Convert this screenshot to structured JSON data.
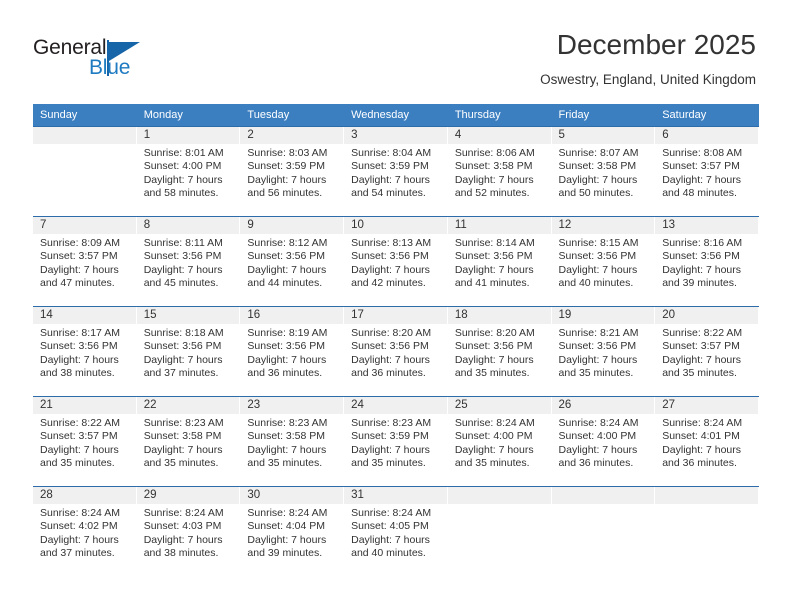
{
  "brand": {
    "name_part1": "General",
    "name_part2": "Blue",
    "logo_icon": "triangle-flag-icon",
    "color_primary": "#1565a8",
    "color_text": "#231f20"
  },
  "header": {
    "title": "December 2025",
    "subtitle": "Oswestry, England, United Kingdom"
  },
  "colors": {
    "header_row_bg": "#3c7fc1",
    "header_row_text": "#ffffff",
    "day_number_bg": "#f0f0f0",
    "row_divider": "#2d6ca8",
    "body_text": "#333333"
  },
  "calendar": {
    "weekday_headers": [
      "Sunday",
      "Monday",
      "Tuesday",
      "Wednesday",
      "Thursday",
      "Friday",
      "Saturday"
    ],
    "weeks": [
      [
        {
          "day": "",
          "sunrise": "",
          "sunset": "",
          "daylight_line1": "",
          "daylight_line2": "",
          "empty": true
        },
        {
          "day": "1",
          "sunrise": "Sunrise: 8:01 AM",
          "sunset": "Sunset: 4:00 PM",
          "daylight_line1": "Daylight: 7 hours",
          "daylight_line2": "and 58 minutes.",
          "empty": false
        },
        {
          "day": "2",
          "sunrise": "Sunrise: 8:03 AM",
          "sunset": "Sunset: 3:59 PM",
          "daylight_line1": "Daylight: 7 hours",
          "daylight_line2": "and 56 minutes.",
          "empty": false
        },
        {
          "day": "3",
          "sunrise": "Sunrise: 8:04 AM",
          "sunset": "Sunset: 3:59 PM",
          "daylight_line1": "Daylight: 7 hours",
          "daylight_line2": "and 54 minutes.",
          "empty": false
        },
        {
          "day": "4",
          "sunrise": "Sunrise: 8:06 AM",
          "sunset": "Sunset: 3:58 PM",
          "daylight_line1": "Daylight: 7 hours",
          "daylight_line2": "and 52 minutes.",
          "empty": false
        },
        {
          "day": "5",
          "sunrise": "Sunrise: 8:07 AM",
          "sunset": "Sunset: 3:58 PM",
          "daylight_line1": "Daylight: 7 hours",
          "daylight_line2": "and 50 minutes.",
          "empty": false
        },
        {
          "day": "6",
          "sunrise": "Sunrise: 8:08 AM",
          "sunset": "Sunset: 3:57 PM",
          "daylight_line1": "Daylight: 7 hours",
          "daylight_line2": "and 48 minutes.",
          "empty": false
        }
      ],
      [
        {
          "day": "7",
          "sunrise": "Sunrise: 8:09 AM",
          "sunset": "Sunset: 3:57 PM",
          "daylight_line1": "Daylight: 7 hours",
          "daylight_line2": "and 47 minutes.",
          "empty": false
        },
        {
          "day": "8",
          "sunrise": "Sunrise: 8:11 AM",
          "sunset": "Sunset: 3:56 PM",
          "daylight_line1": "Daylight: 7 hours",
          "daylight_line2": "and 45 minutes.",
          "empty": false
        },
        {
          "day": "9",
          "sunrise": "Sunrise: 8:12 AM",
          "sunset": "Sunset: 3:56 PM",
          "daylight_line1": "Daylight: 7 hours",
          "daylight_line2": "and 44 minutes.",
          "empty": false
        },
        {
          "day": "10",
          "sunrise": "Sunrise: 8:13 AM",
          "sunset": "Sunset: 3:56 PM",
          "daylight_line1": "Daylight: 7 hours",
          "daylight_line2": "and 42 minutes.",
          "empty": false
        },
        {
          "day": "11",
          "sunrise": "Sunrise: 8:14 AM",
          "sunset": "Sunset: 3:56 PM",
          "daylight_line1": "Daylight: 7 hours",
          "daylight_line2": "and 41 minutes.",
          "empty": false
        },
        {
          "day": "12",
          "sunrise": "Sunrise: 8:15 AM",
          "sunset": "Sunset: 3:56 PM",
          "daylight_line1": "Daylight: 7 hours",
          "daylight_line2": "and 40 minutes.",
          "empty": false
        },
        {
          "day": "13",
          "sunrise": "Sunrise: 8:16 AM",
          "sunset": "Sunset: 3:56 PM",
          "daylight_line1": "Daylight: 7 hours",
          "daylight_line2": "and 39 minutes.",
          "empty": false
        }
      ],
      [
        {
          "day": "14",
          "sunrise": "Sunrise: 8:17 AM",
          "sunset": "Sunset: 3:56 PM",
          "daylight_line1": "Daylight: 7 hours",
          "daylight_line2": "and 38 minutes.",
          "empty": false
        },
        {
          "day": "15",
          "sunrise": "Sunrise: 8:18 AM",
          "sunset": "Sunset: 3:56 PM",
          "daylight_line1": "Daylight: 7 hours",
          "daylight_line2": "and 37 minutes.",
          "empty": false
        },
        {
          "day": "16",
          "sunrise": "Sunrise: 8:19 AM",
          "sunset": "Sunset: 3:56 PM",
          "daylight_line1": "Daylight: 7 hours",
          "daylight_line2": "and 36 minutes.",
          "empty": false
        },
        {
          "day": "17",
          "sunrise": "Sunrise: 8:20 AM",
          "sunset": "Sunset: 3:56 PM",
          "daylight_line1": "Daylight: 7 hours",
          "daylight_line2": "and 36 minutes.",
          "empty": false
        },
        {
          "day": "18",
          "sunrise": "Sunrise: 8:20 AM",
          "sunset": "Sunset: 3:56 PM",
          "daylight_line1": "Daylight: 7 hours",
          "daylight_line2": "and 35 minutes.",
          "empty": false
        },
        {
          "day": "19",
          "sunrise": "Sunrise: 8:21 AM",
          "sunset": "Sunset: 3:56 PM",
          "daylight_line1": "Daylight: 7 hours",
          "daylight_line2": "and 35 minutes.",
          "empty": false
        },
        {
          "day": "20",
          "sunrise": "Sunrise: 8:22 AM",
          "sunset": "Sunset: 3:57 PM",
          "daylight_line1": "Daylight: 7 hours",
          "daylight_line2": "and 35 minutes.",
          "empty": false
        }
      ],
      [
        {
          "day": "21",
          "sunrise": "Sunrise: 8:22 AM",
          "sunset": "Sunset: 3:57 PM",
          "daylight_line1": "Daylight: 7 hours",
          "daylight_line2": "and 35 minutes.",
          "empty": false
        },
        {
          "day": "22",
          "sunrise": "Sunrise: 8:23 AM",
          "sunset": "Sunset: 3:58 PM",
          "daylight_line1": "Daylight: 7 hours",
          "daylight_line2": "and 35 minutes.",
          "empty": false
        },
        {
          "day": "23",
          "sunrise": "Sunrise: 8:23 AM",
          "sunset": "Sunset: 3:58 PM",
          "daylight_line1": "Daylight: 7 hours",
          "daylight_line2": "and 35 minutes.",
          "empty": false
        },
        {
          "day": "24",
          "sunrise": "Sunrise: 8:23 AM",
          "sunset": "Sunset: 3:59 PM",
          "daylight_line1": "Daylight: 7 hours",
          "daylight_line2": "and 35 minutes.",
          "empty": false
        },
        {
          "day": "25",
          "sunrise": "Sunrise: 8:24 AM",
          "sunset": "Sunset: 4:00 PM",
          "daylight_line1": "Daylight: 7 hours",
          "daylight_line2": "and 35 minutes.",
          "empty": false
        },
        {
          "day": "26",
          "sunrise": "Sunrise: 8:24 AM",
          "sunset": "Sunset: 4:00 PM",
          "daylight_line1": "Daylight: 7 hours",
          "daylight_line2": "and 36 minutes.",
          "empty": false
        },
        {
          "day": "27",
          "sunrise": "Sunrise: 8:24 AM",
          "sunset": "Sunset: 4:01 PM",
          "daylight_line1": "Daylight: 7 hours",
          "daylight_line2": "and 36 minutes.",
          "empty": false
        }
      ],
      [
        {
          "day": "28",
          "sunrise": "Sunrise: 8:24 AM",
          "sunset": "Sunset: 4:02 PM",
          "daylight_line1": "Daylight: 7 hours",
          "daylight_line2": "and 37 minutes.",
          "empty": false
        },
        {
          "day": "29",
          "sunrise": "Sunrise: 8:24 AM",
          "sunset": "Sunset: 4:03 PM",
          "daylight_line1": "Daylight: 7 hours",
          "daylight_line2": "and 38 minutes.",
          "empty": false
        },
        {
          "day": "30",
          "sunrise": "Sunrise: 8:24 AM",
          "sunset": "Sunset: 4:04 PM",
          "daylight_line1": "Daylight: 7 hours",
          "daylight_line2": "and 39 minutes.",
          "empty": false
        },
        {
          "day": "31",
          "sunrise": "Sunrise: 8:24 AM",
          "sunset": "Sunset: 4:05 PM",
          "daylight_line1": "Daylight: 7 hours",
          "daylight_line2": "and 40 minutes.",
          "empty": false
        },
        {
          "day": "",
          "sunrise": "",
          "sunset": "",
          "daylight_line1": "",
          "daylight_line2": "",
          "empty": true
        },
        {
          "day": "",
          "sunrise": "",
          "sunset": "",
          "daylight_line1": "",
          "daylight_line2": "",
          "empty": true
        },
        {
          "day": "",
          "sunrise": "",
          "sunset": "",
          "daylight_line1": "",
          "daylight_line2": "",
          "empty": true
        }
      ]
    ]
  }
}
